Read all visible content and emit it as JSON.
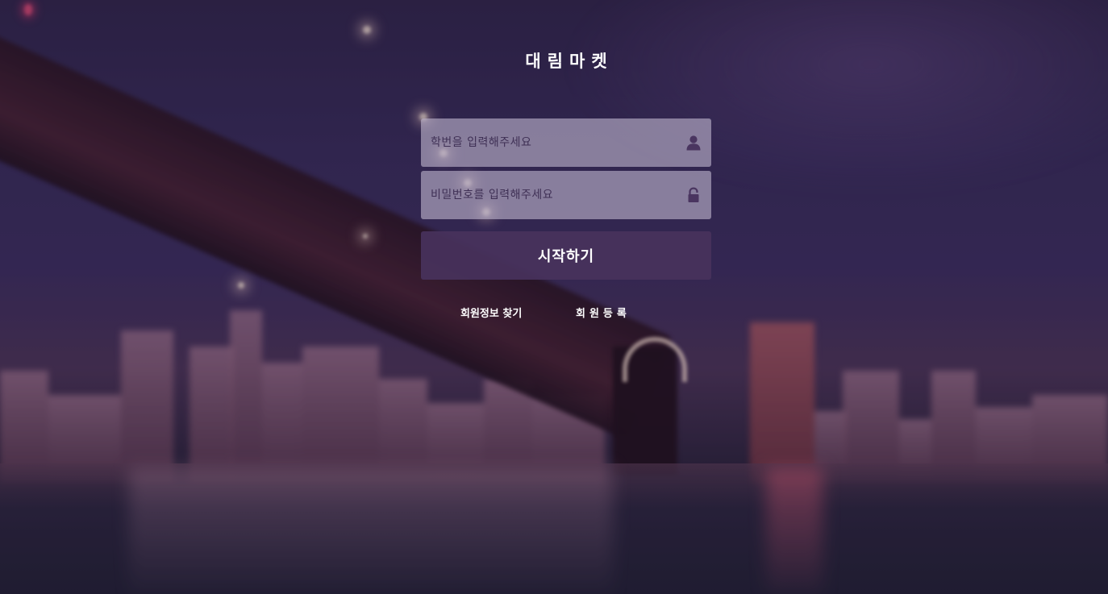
{
  "app": {
    "title": "대림마켓"
  },
  "login": {
    "student_id_placeholder": "학번을 입력해주세요",
    "student_id_value": "",
    "password_placeholder": "비밀번호를 입력해주세요",
    "password_value": "",
    "user_icon": "user-icon",
    "lock_icon": "lock-icon",
    "start_label": "시작하기",
    "find_account_label": "회원정보 찾기",
    "register_label": "회원등록"
  },
  "colors": {
    "button_bg": "#48325c",
    "field_bg": "#beb4cd",
    "icon": "#4a3560",
    "text_light": "#ffffff"
  }
}
